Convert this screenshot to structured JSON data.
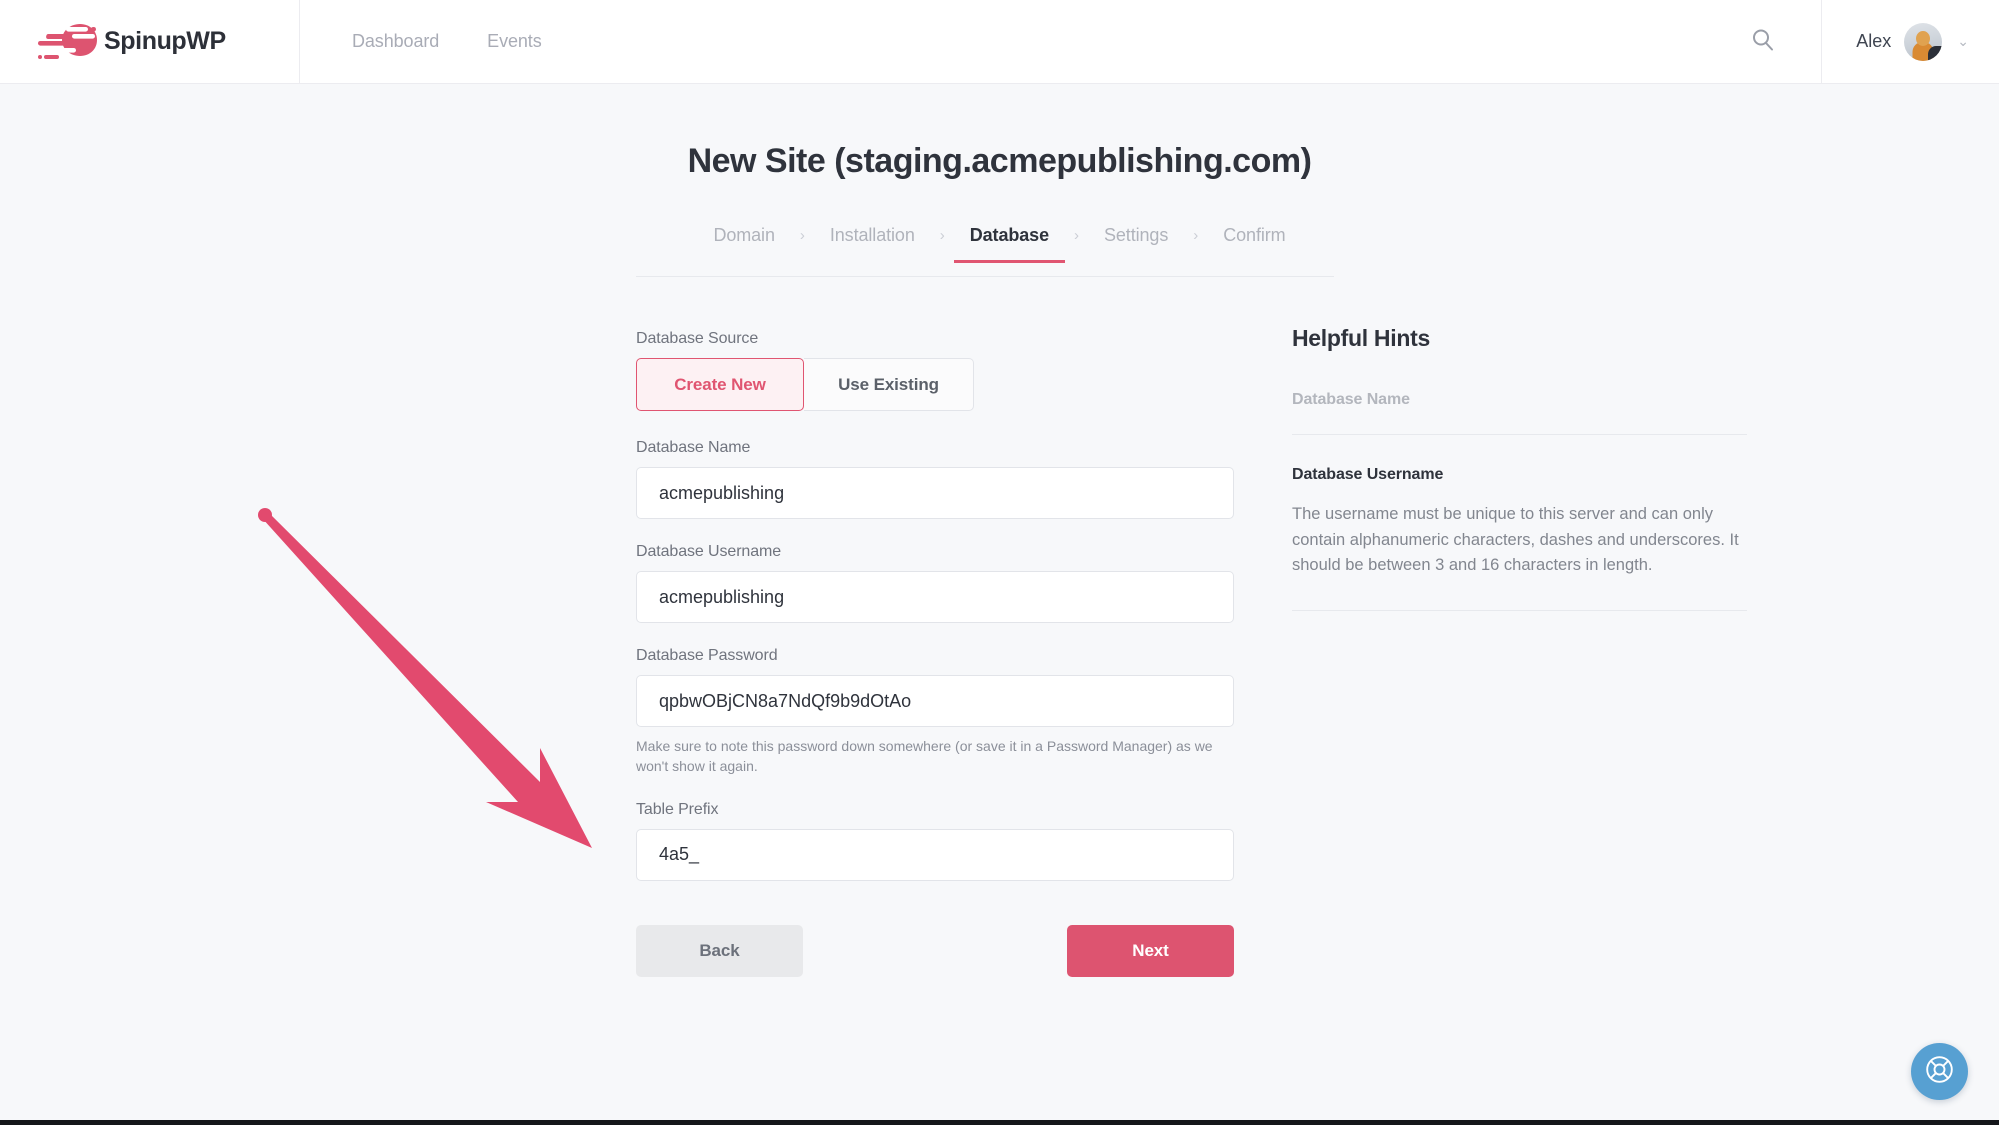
{
  "header": {
    "logo_icon": "spinupwp-speed-logo-icon",
    "wordmark": "SpinupWP",
    "nav": [
      {
        "label": "Dashboard"
      },
      {
        "label": "Events"
      }
    ],
    "search_icon": "search-icon",
    "user_name": "Alex",
    "avatar_icon": "user-avatar",
    "chevron_icon": "chevron-down-icon",
    "chevron_glyph": "⌄"
  },
  "page": {
    "title": "New Site (staging.acmepublishing.com)"
  },
  "steps": {
    "separator": "›",
    "items": [
      {
        "label": "Domain",
        "state": "inactive"
      },
      {
        "label": "Installation",
        "state": "inactive"
      },
      {
        "label": "Database",
        "state": "active"
      },
      {
        "label": "Settings",
        "state": "inactive"
      },
      {
        "label": "Confirm",
        "state": "inactive"
      }
    ]
  },
  "form": {
    "database_source": {
      "label": "Database Source",
      "options": [
        {
          "label": "Create New",
          "selected": true
        },
        {
          "label": "Use Existing",
          "selected": false
        }
      ]
    },
    "database_name": {
      "label": "Database Name",
      "value": "acmepublishing",
      "placeholder": "Database Name"
    },
    "database_username": {
      "label": "Database Username",
      "value": "acmepublishing",
      "placeholder": "Database Username"
    },
    "database_password": {
      "label": "Database Password",
      "value": "qpbwOBjCN8a7NdQf9b9dOtAo",
      "placeholder": "Database Password",
      "help": "Make sure to note this password down somewhere (or save it in a Password Manager) as we won't show it again."
    },
    "table_prefix": {
      "label": "Table Prefix",
      "value": "4a5_",
      "placeholder": "Table Prefix"
    },
    "back_label": "Back",
    "next_label": "Next"
  },
  "hints": {
    "title": "Helpful Hints",
    "items": [
      {
        "heading": "Database Name",
        "body": ""
      },
      {
        "heading": "Database Username",
        "body": "The username must be unique to this server and can only contain alphanumeric characters, dashes and underscores. It should be between 3 and 16 characters in length."
      }
    ]
  },
  "support": {
    "icon": "lifebuoy-icon"
  },
  "annotation": {
    "arrow_icon": "pointer-arrow-icon",
    "color": "#e24a6e"
  },
  "colors": {
    "brand_pink": "#dd5470",
    "accent_pink": "#e05571",
    "page_background": "#f7f8fa",
    "header_background": "#ffffff",
    "support_blue": "#57a0d2",
    "text_dark": "#2f333c",
    "text_muted": "#82868f"
  }
}
